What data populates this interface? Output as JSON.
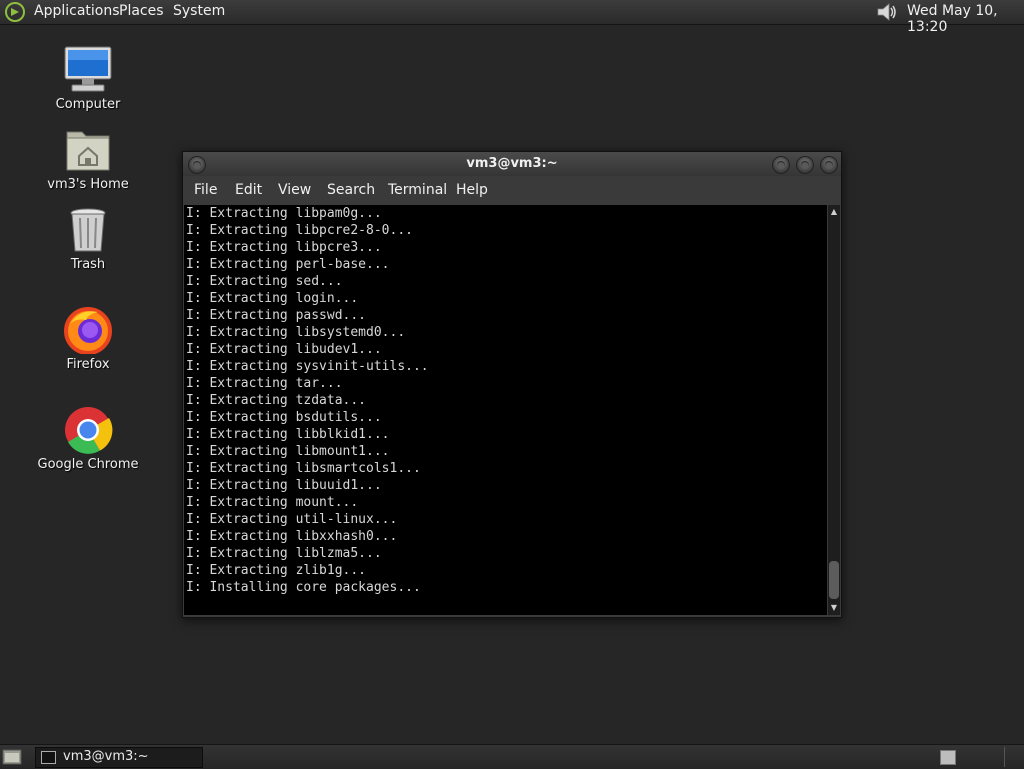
{
  "top_panel": {
    "menus": [
      "Applications",
      "Places",
      "System"
    ],
    "clock": "Wed May 10, 13:20"
  },
  "desktop": {
    "icons": [
      {
        "label": "Computer",
        "icon": "computer-icon"
      },
      {
        "label": "vm3's Home",
        "icon": "home-folder-icon"
      },
      {
        "label": "Trash",
        "icon": "trash-icon"
      },
      {
        "label": "Firefox",
        "icon": "firefox-icon"
      },
      {
        "label": "Google Chrome",
        "icon": "chrome-icon"
      }
    ]
  },
  "terminal": {
    "title": "vm3@vm3:~",
    "menu": [
      "File",
      "Edit",
      "View",
      "Search",
      "Terminal",
      "Help"
    ],
    "lines": [
      "I: Extracting libpam0g...",
      "I: Extracting libpcre2-8-0...",
      "I: Extracting libpcre3...",
      "I: Extracting perl-base...",
      "I: Extracting sed...",
      "I: Extracting login...",
      "I: Extracting passwd...",
      "I: Extracting libsystemd0...",
      "I: Extracting libudev1...",
      "I: Extracting sysvinit-utils...",
      "I: Extracting tar...",
      "I: Extracting tzdata...",
      "I: Extracting bsdutils...",
      "I: Extracting libblkid1...",
      "I: Extracting libmount1...",
      "I: Extracting libsmartcols1...",
      "I: Extracting libuuid1...",
      "I: Extracting mount...",
      "I: Extracting util-linux...",
      "I: Extracting libxxhash0...",
      "I: Extracting liblzma5...",
      "I: Extracting zlib1g...",
      "I: Installing core packages..."
    ]
  },
  "taskbar": {
    "tasks": [
      {
        "label": "vm3@vm3:~"
      }
    ]
  }
}
